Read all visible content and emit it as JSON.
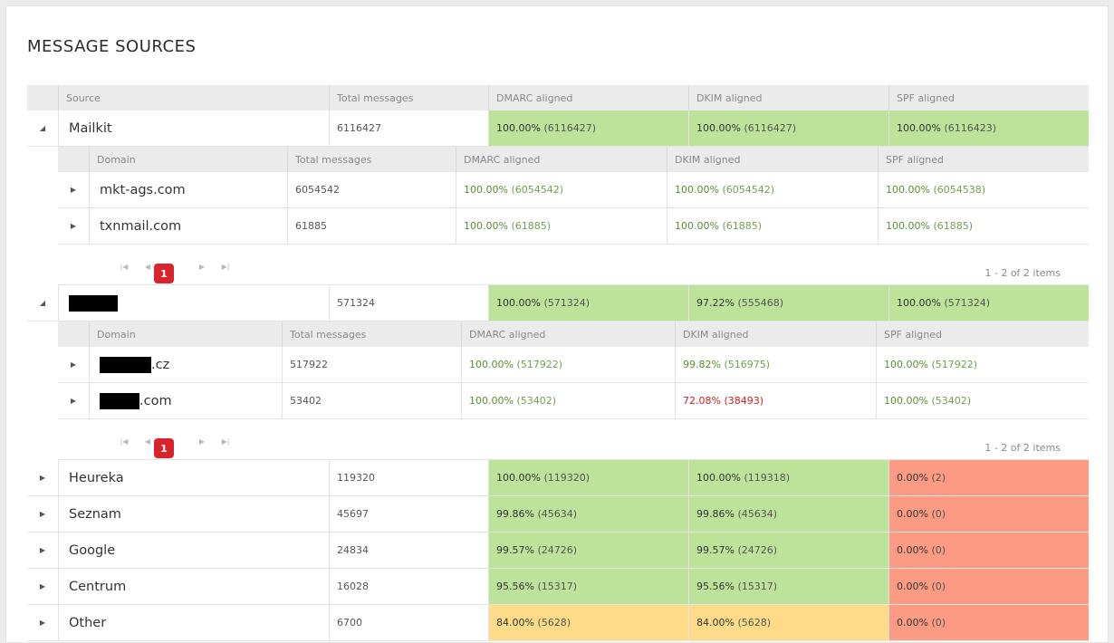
{
  "title": "MESSAGE SOURCES",
  "columns": [
    "Source",
    "Total messages",
    "DMARC aligned",
    "DKIM aligned",
    "SPF aligned"
  ],
  "sub_columns": [
    "Domain",
    "Total messages",
    "DMARC aligned",
    "DKIM aligned",
    "SPF aligned"
  ],
  "colors": {
    "green": "#bde39b",
    "red": "#fb9b83",
    "orange": "#fedb88",
    "pager_active": "#d9232d",
    "text_green": "#5a8e2e",
    "text_red": "#cc2020"
  },
  "groups": [
    {
      "source": "Mailkit",
      "expanded": true,
      "total": "6116427",
      "dmarc": {
        "pct": "100.00%",
        "count": "(6116427)"
      },
      "dkim": {
        "pct": "100.00%",
        "count": "(6116427)"
      },
      "spf": {
        "pct": "100.00%",
        "count": "(6116423)"
      },
      "domains": [
        {
          "domain": "mkt-ags.com",
          "total": "6054542",
          "dmarc": {
            "pct": "100.00%",
            "count": "(6054542)"
          },
          "dkim": {
            "pct": "100.00%",
            "count": "(6054542)"
          },
          "spf": {
            "pct": "100.00%",
            "count": "(6054538)"
          }
        },
        {
          "domain": "txnmail.com",
          "total": "61885",
          "dmarc": {
            "pct": "100.00%",
            "count": "(61885)"
          },
          "dkim": {
            "pct": "100.00%",
            "count": "(61885)"
          },
          "spf": {
            "pct": "100.00%",
            "count": "(61885)"
          }
        }
      ],
      "pager": {
        "page": "1",
        "info": "1 - 2 of 2 items"
      }
    },
    {
      "source": "",
      "expanded": true,
      "total": "571324",
      "dmarc": {
        "pct": "100.00%",
        "count": "(571324)"
      },
      "dkim": {
        "pct": "97.22%",
        "count": "(555468)"
      },
      "spf": {
        "pct": "100.00%",
        "count": "(571324)"
      },
      "domains": [
        {
          "domain_suffix": ".cz",
          "total": "517922",
          "dmarc": {
            "pct": "100.00%",
            "count": "(517922)"
          },
          "dkim": {
            "pct": "99.82%",
            "count": "(516975)"
          },
          "spf": {
            "pct": "100.00%",
            "count": "(517922)"
          }
        },
        {
          "domain_suffix": ".com",
          "total": "53402",
          "dmarc": {
            "pct": "100.00%",
            "count": "(53402)"
          },
          "dkim": {
            "pct": "72.08%",
            "count": "(38493)"
          },
          "spf": {
            "pct": "100.00%",
            "count": "(53402)"
          }
        }
      ],
      "pager": {
        "page": "1",
        "info": "1 - 2 of 2 items"
      }
    },
    {
      "source": "Heureka",
      "total": "119320",
      "dmarc": {
        "pct": "100.00%",
        "count": "(119320)"
      },
      "dkim": {
        "pct": "100.00%",
        "count": "(119318)"
      },
      "spf": {
        "pct": "0.00%",
        "count": "(2)"
      }
    },
    {
      "source": "Seznam",
      "total": "45697",
      "dmarc": {
        "pct": "99.86%",
        "count": "(45634)"
      },
      "dkim": {
        "pct": "99.86%",
        "count": "(45634)"
      },
      "spf": {
        "pct": "0.00%",
        "count": "(0)"
      }
    },
    {
      "source": "Google",
      "total": "24834",
      "dmarc": {
        "pct": "99.57%",
        "count": "(24726)"
      },
      "dkim": {
        "pct": "99.57%",
        "count": "(24726)"
      },
      "spf": {
        "pct": "0.00%",
        "count": "(0)"
      }
    },
    {
      "source": "Centrum",
      "total": "16028",
      "dmarc": {
        "pct": "95.56%",
        "count": "(15317)"
      },
      "dkim": {
        "pct": "95.56%",
        "count": "(15317)"
      },
      "spf": {
        "pct": "0.00%",
        "count": "(0)"
      }
    },
    {
      "source": "Other",
      "total": "6700",
      "dmarc": {
        "pct": "84.00%",
        "count": "(5628)"
      },
      "dkim": {
        "pct": "84.00%",
        "count": "(5628)"
      },
      "spf": {
        "pct": "0.00%",
        "count": "(0)"
      }
    }
  ]
}
